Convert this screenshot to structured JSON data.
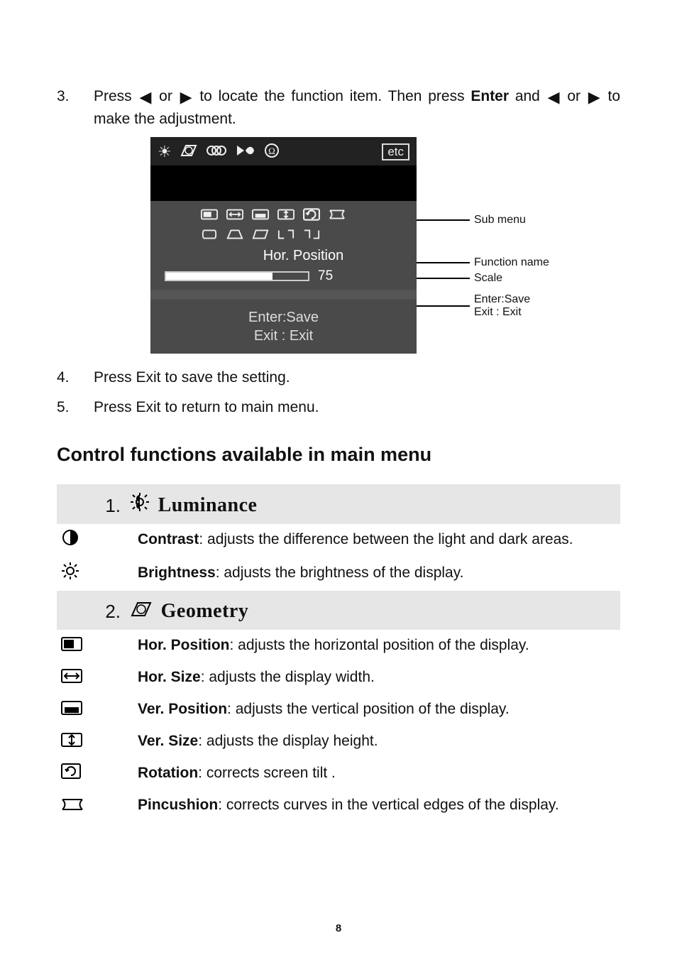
{
  "steps": {
    "s3": {
      "num": "3.",
      "text_a": "Press ",
      "text_b": " or ",
      "text_c": "  to  locate  the  function  item.    Then  press ",
      "enter": "Enter",
      "text_d": " and ",
      "text_e": " or ",
      "text_f": "  to make the adjustment."
    },
    "s4": {
      "num": "4.",
      "text": "Press Exit to save the setting."
    },
    "s5": {
      "num": "5.",
      "text": "Press Exit to return to main menu."
    }
  },
  "osd": {
    "tabs_etc": "etc",
    "function_name": "Hor. Position",
    "scale_value": "75",
    "enter_line": "Enter:Save",
    "exit_line": "Exit  : Exit"
  },
  "callouts": {
    "sub_menu": "Sub menu",
    "function_name": "Function name",
    "scale": "Scale",
    "hint1": "Enter:Save",
    "hint2": "Exit  : Exit"
  },
  "section_title": "Control functions available in main menu",
  "menu1": {
    "num": "1.",
    "title": "Luminance",
    "contrast_label": "Contrast",
    "contrast_desc": ": adjusts the difference between the light and dark areas.",
    "brightness_label": "Brightness",
    "brightness_desc": ": adjusts the brightness of the display."
  },
  "menu2": {
    "num": "2.",
    "title": "Geometry",
    "items": [
      {
        "label": "Hor. Position",
        "desc": ": adjusts the horizontal position of the display."
      },
      {
        "label": "Hor. Size",
        "desc": ": adjusts the display width."
      },
      {
        "label": "Ver. Position",
        "desc": ": adjusts the vertical position of the display."
      },
      {
        "label": "Ver. Size",
        "desc": ": adjusts the display height."
      },
      {
        "label": "Rotation",
        "desc": ": corrects screen tilt ."
      },
      {
        "label": "Pincushion",
        "desc": ": corrects curves in the vertical edges of the display."
      }
    ]
  },
  "page_number": "8"
}
